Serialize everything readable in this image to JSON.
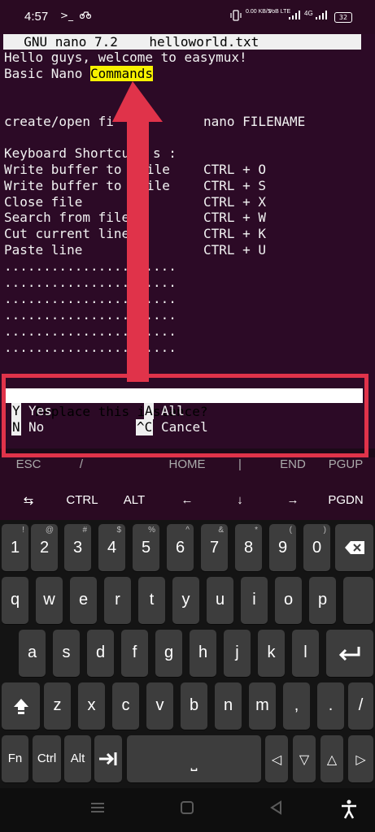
{
  "status_bar": {
    "time": "4:57",
    "left_icons": [
      ">_",
      "bike-icon"
    ],
    "data_speed": "0.00\nKB/S",
    "volte": "VoB\nLTE",
    "network": "4G",
    "battery": "32"
  },
  "nano": {
    "title": "  GNU nano 7.2    helloworld.txt",
    "line1": "Hello guys, welcome to easymux!",
    "line2_prefix": "Basic Nano ",
    "line2_highlight": "Commands",
    "line_create_cmd": "create/open fi",
    "line_create_val": "nano FILENAME",
    "shortcuts_heading": "Keyboard Shortcu",
    "shortcuts_heading_end": "s :",
    "shortcuts": [
      {
        "action": "Write buffer to ",
        "action_end": "ile",
        "keys": "CTRL + O"
      },
      {
        "action": "Write buffer to ",
        "action_end": "ile",
        "keys": "CTRL + S"
      },
      {
        "action": "Close file",
        "action_end": "",
        "keys": "CTRL + X"
      },
      {
        "action": "Search from file",
        "action_end": "",
        "keys": "CTRL + W"
      },
      {
        "action": "Cut current line",
        "action_end": "",
        "keys": "CTRL + K"
      },
      {
        "action": "Paste line",
        "action_end": "",
        "keys": "CTRL + U"
      }
    ],
    "dots": [
      "......................",
      "......................",
      "......................",
      "......................",
      "......................",
      "......................"
    ],
    "prompt": "Replace this instance?",
    "options": [
      {
        "key": "Y",
        "label": "Yes"
      },
      {
        "key": "A",
        "label": "All"
      },
      {
        "key": "N",
        "label": "No"
      },
      {
        "key": "^C",
        "label": "Cancel"
      }
    ]
  },
  "extra_keys": {
    "row1": [
      "ESC",
      "/",
      "HOME",
      "|",
      "END",
      "PGUP"
    ],
    "row2": [
      "⇆",
      "CTRL",
      "ALT",
      "←",
      "↓",
      "→",
      "PGDN"
    ]
  },
  "keyboard": {
    "numbers": [
      "1",
      "2",
      "3",
      "4",
      "5",
      "6",
      "7",
      "8",
      "9",
      "0"
    ],
    "number_hints": [
      "!",
      "@",
      "#",
      "$",
      "%",
      "^",
      "&",
      "*",
      "(",
      ")"
    ],
    "row_q": [
      "q",
      "w",
      "e",
      "r",
      "t",
      "y",
      "u",
      "i",
      "o",
      "p"
    ],
    "row_a": [
      "a",
      "s",
      "d",
      "f",
      "g",
      "h",
      "j",
      "k",
      "l"
    ],
    "row_z": [
      "z",
      "x",
      "c",
      "v",
      "b",
      "n",
      "m",
      ",",
      ".",
      " /"
    ],
    "bottom": [
      "Fn",
      "Ctrl",
      "Alt"
    ],
    "arrows": [
      "◁",
      "▽",
      "△",
      "▷"
    ],
    "space": "⎵"
  },
  "colors": {
    "terminal_bg": "#2c0a26",
    "highlight": "#f7f200",
    "annotation": "#e0334a"
  }
}
